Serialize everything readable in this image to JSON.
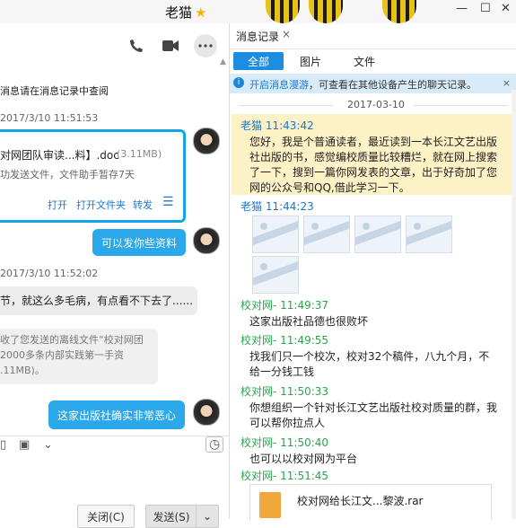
{
  "window": {
    "title": "老猫",
    "star": "★",
    "minimize": "—",
    "maximize": "☐",
    "close": "✕"
  },
  "toolbar": {
    "phone_icon": "phone",
    "video_icon": "video",
    "more_icon": "more"
  },
  "chat": {
    "system_msg": "消息请在消息记录中查阅",
    "ts1": "2017/3/10 11:51:53",
    "file": {
      "name": "对网团队审读...料】.doc",
      "size": "(3.11MB)",
      "note": "功发送文件，文件助手暂存7天",
      "open": "打开",
      "open_folder": "打开文件夹",
      "forward": "转发",
      "menu": "☰"
    },
    "bubble1": "可以发你些资料",
    "ts2": "2017/3/10 11:52:02",
    "bubble2": "节，就这么多毛病，有点看不下去了......",
    "notice": [
      "收了您发送的离线文件“校对网团",
      "2000多条内部实践第一手资",
      ".11MB)。"
    ],
    "bubble3": "这家出版社确实非常恶心"
  },
  "bottom": {
    "close": "关闭(C)",
    "send": "发送(S)",
    "dropdown": "⌄"
  },
  "record": {
    "tab": "消息记录",
    "tab_close": "×",
    "filters": [
      "全部",
      "图片",
      "文件"
    ],
    "info": {
      "icon": "i",
      "pre": "开启",
      "link": "消息漫游",
      "text": "，可查看在其他设备产生的聊天记录。",
      "close": "×"
    },
    "date": "2017-03-10",
    "messages": [
      {
        "sender": "老猫 11:43:42",
        "lines": [
          "您好，我是个普通读者，最近读到一本长江文艺出版",
          "社出版的书，感觉编校质量比较糟烂，就在网上搜索",
          "了一下，搜到一篇你网发表的文章，出于好奇加了您",
          "网的公众号和QQ,借此学习一下。"
        ]
      },
      {
        "sender": "老猫 11:44:23"
      },
      {
        "sender": "校对网- 11:49:37",
        "text": "这家出版社品德也很败坏"
      },
      {
        "sender": "校对网- 11:49:55",
        "lines": [
          "找我们只一个校次，校对32个稿件，八九个月，不",
          "给一分钱工钱"
        ]
      },
      {
        "sender": "校对网- 11:50:33",
        "lines": [
          "你想组织一个针对长江文艺出版社校对质量的群，我",
          "可以帮你拉点人"
        ]
      },
      {
        "sender": "校对网- 11:50:40",
        "text": "也可以以校对网为平台"
      },
      {
        "sender": "校对网- 11:51:45"
      }
    ],
    "file_name": "校对网给长江文...黎波.rar"
  }
}
